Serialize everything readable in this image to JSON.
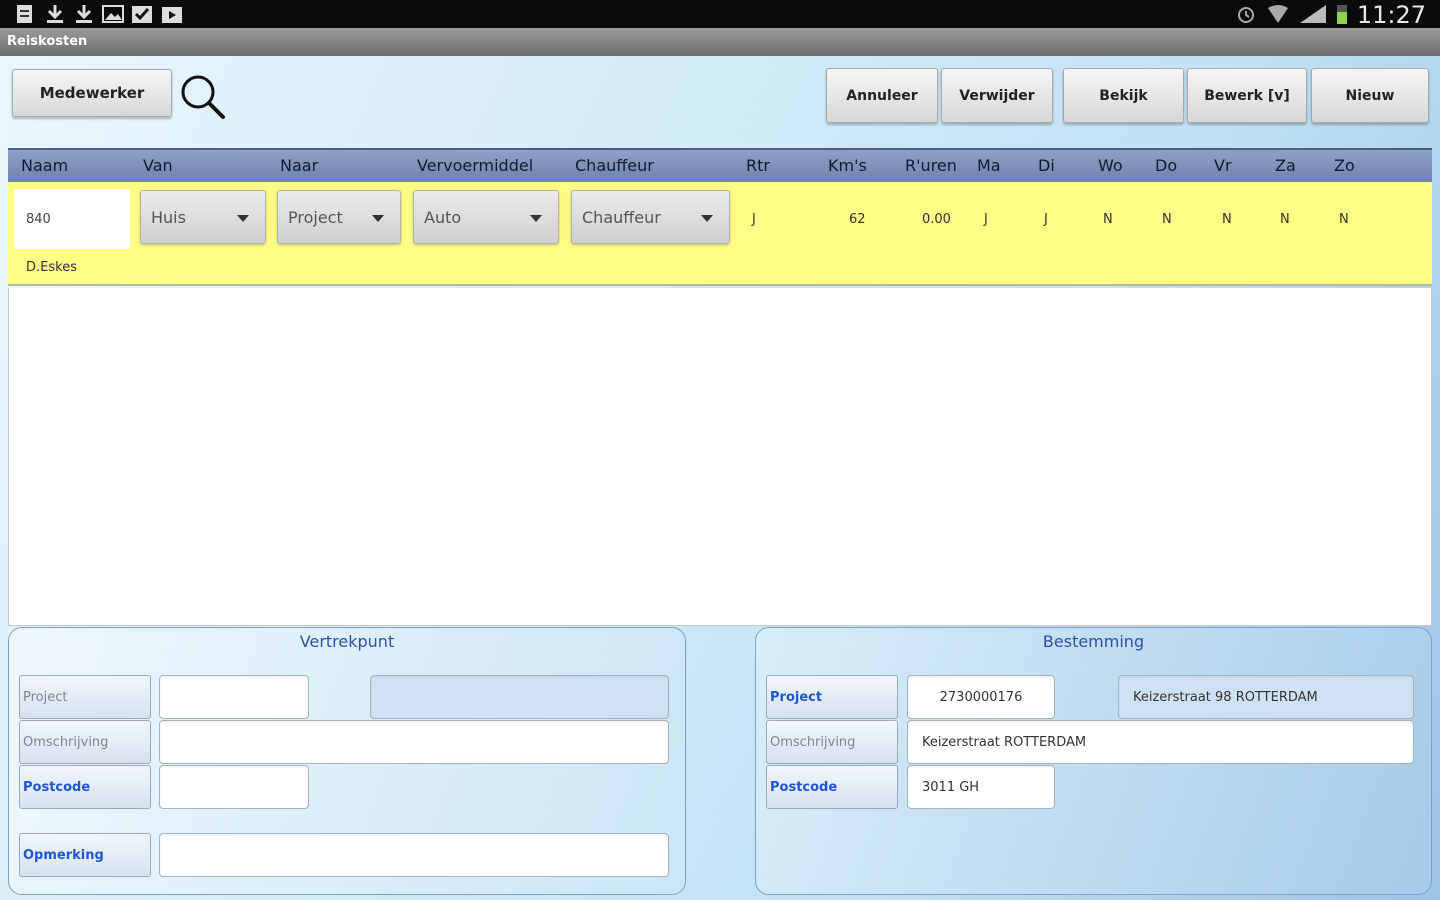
{
  "status_bar": {
    "clock": "11:27",
    "notification_icons": [
      "document-icon",
      "download-icon",
      "download-icon",
      "image-icon",
      "checkbox-icon",
      "play-icon"
    ],
    "system_icons": [
      "alarm-icon",
      "wifi-icon",
      "signal-icon",
      "battery-icon"
    ]
  },
  "app": {
    "title": "Reiskosten"
  },
  "toolbar": {
    "medewerker": "Medewerker",
    "annuleer": "Annuleer",
    "verwijder": "Verwijder",
    "bekijk": "Bekijk",
    "bewerk": "Bewerk [v]",
    "nieuw": "Nieuw"
  },
  "table": {
    "headers": [
      "Naam",
      "Van",
      "Naar",
      "Vervoermiddel",
      "Chauffeur",
      "Rtr",
      "Km's",
      "R'uren",
      "Ma",
      "Di",
      "Wo",
      "Do",
      "Vr",
      "Za",
      "Zo"
    ],
    "row": {
      "naam": "840",
      "naam_sub": "D.Eskes",
      "van": "Huis",
      "naar": "Project",
      "vervoermiddel": "Auto",
      "chauffeur": "Chauffeur",
      "rtr": "J",
      "kms": "62",
      "ruren": "0.00",
      "ma": "J",
      "di": "J",
      "wo": "N",
      "do": "N",
      "vr": "N",
      "za": "N",
      "zo": "N"
    }
  },
  "vertrekpunt": {
    "title": "Vertrekpunt",
    "project_label": "Project",
    "omschrijving_label": "Omschrijving",
    "postcode_label": "Postcode",
    "opmerking_label": "Opmerking",
    "project_value": "",
    "project_desc": "",
    "omschrijving_value": "",
    "postcode_value": "",
    "opmerking_value": ""
  },
  "bestemming": {
    "title": "Bestemming",
    "project_label": "Project",
    "omschrijving_label": "Omschrijving",
    "postcode_label": "Postcode",
    "project_value": "2730000176",
    "project_desc": "Keizerstraat 98 ROTTERDAM",
    "omschrijving_value": "Keizerstraat ROTTERDAM",
    "postcode_value": "3011 GH"
  }
}
